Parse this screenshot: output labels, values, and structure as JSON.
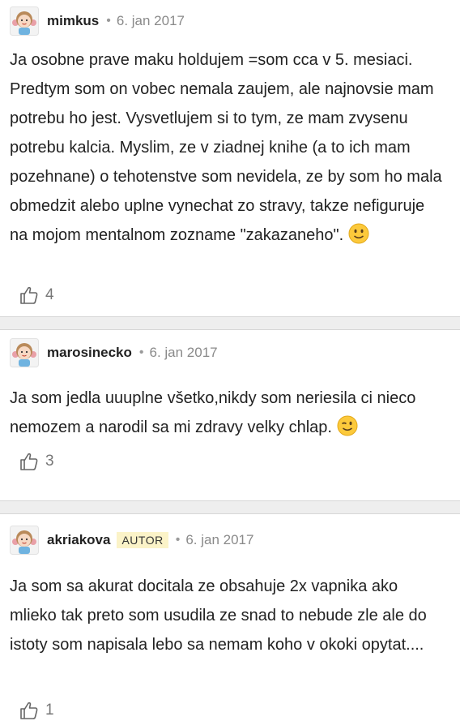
{
  "comments": [
    {
      "username": "mimkus",
      "dot": "•",
      "date": "6. jan 2017",
      "badge": "",
      "text": "Ja osobne prave maku holdujem =som cca v 5. mesiaci. Predtym som on vobec nemala zaujem, ale najnovsie mam potrebu ho jest. Vysvetlujem si to tym, ze mam zvysenu potrebu kalcia. Myslim, ze v ziadnej knihe (a to ich mam pozehnane) o tehotenstve som nevidela, ze by som ho mala obmedzit alebo uplne vynechat zo stravy, takze nefiguruje na mojom mentalnom zozname \"zakazaneho\".",
      "emoji": "slightly-smiling-face-emoji",
      "likes": "4"
    },
    {
      "username": "marosinecko",
      "dot": "•",
      "date": "6. jan 2017",
      "badge": "",
      "text": "Ja som jedla uuuplne všetko,nikdy som neriesila ci nieco nemozem a narodil sa mi zdravy velky chlap.",
      "emoji": "winking-face-emoji",
      "likes": "3"
    },
    {
      "username": "akriakova",
      "dot": "•",
      "date": "6. jan 2017",
      "badge": "AUTOR",
      "text": "Ja som sa akurat docitala ze obsahuje 2x vapnika ako mlieko tak preto som usudila ze snad to nebude zle ale do istoty som napisala lebo sa nemam koho v okoki opytat....",
      "emoji": "",
      "likes": "1"
    }
  ],
  "icons": {
    "avatar": "girl-avatar-icon",
    "like": "thumbs-up-icon"
  },
  "colors": {
    "badge_bg": "#fbf3c8",
    "separator": "#eeeeee",
    "meta_text": "#8a8a8a"
  }
}
